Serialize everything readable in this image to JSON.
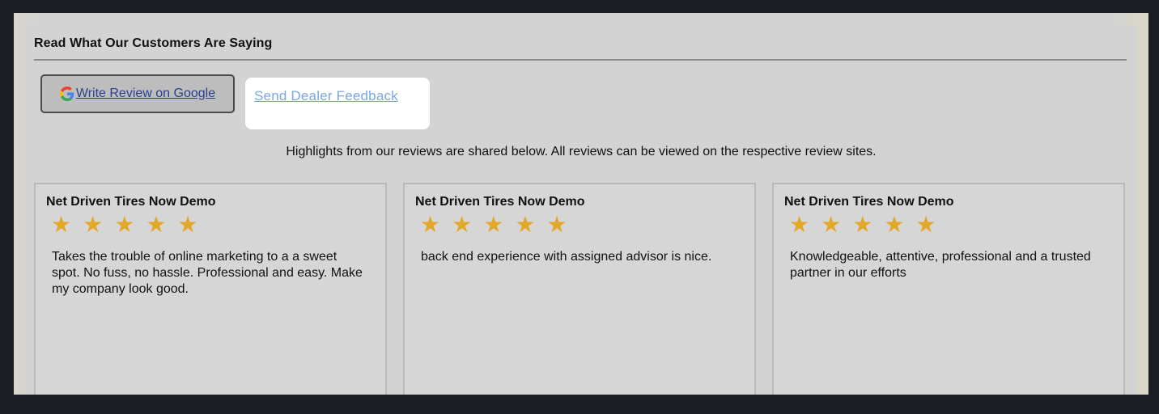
{
  "section": {
    "title": "Read What Our Customers Are Saying"
  },
  "actions": {
    "google_review_label": " Write Review on Google",
    "dealer_feedback_label": "Send Dealer Feedback"
  },
  "highlights_text": "Highlights from our reviews are shared below. All reviews can be viewed on the respective review sites.",
  "colors": {
    "star": "#e2a82a",
    "google_link": "#2a3f8e",
    "feedback_link": "#7aa7e0"
  },
  "reviews": [
    {
      "author": "Net Driven Tires Now Demo",
      "rating": 5,
      "text": "Takes the trouble of online marketing to a a sweet spot. No fuss, no hassle. Professional and easy. Make my company look good."
    },
    {
      "author": "Net Driven Tires Now Demo",
      "rating": 5,
      "text": "back end experience with assigned advisor is nice."
    },
    {
      "author": "Net Driven Tires Now Demo",
      "rating": 5,
      "text": "Knowledgeable, attentive, professional and a trusted partner in our efforts"
    }
  ]
}
